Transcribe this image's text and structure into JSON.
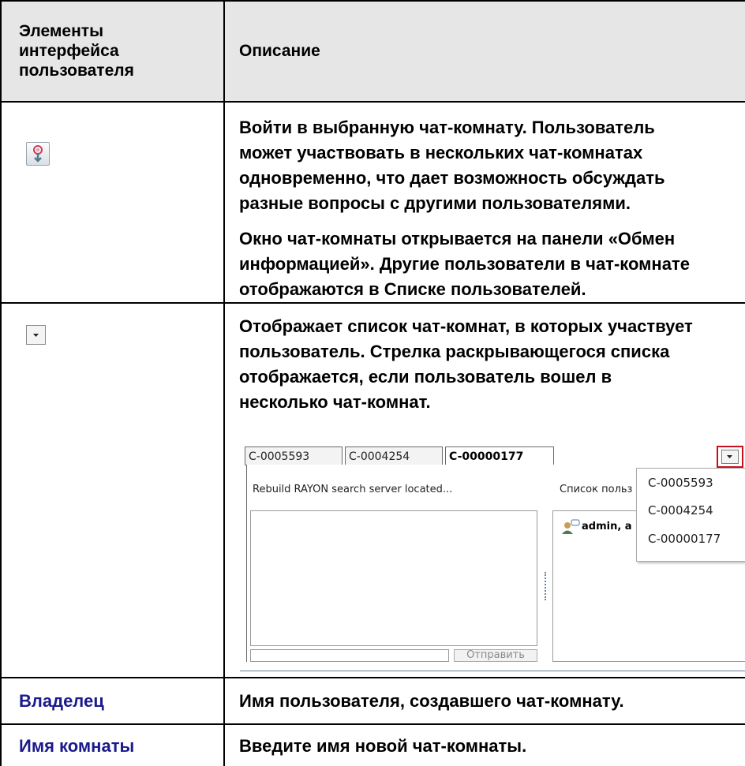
{
  "table": {
    "header": {
      "col1": [
        "Элементы",
        "интерфейса",
        "пользователя"
      ],
      "col2": "Описание"
    },
    "rows": [
      {
        "icon": "enter-chat-room-icon",
        "paragraphs": [
          [
            "Войти в выбранную чат-комнату. Пользователь",
            "может участвовать в нескольких чат-комнатах",
            "одновременно, что дает возможность обсуждать",
            "разные вопросы с другими пользователями."
          ],
          [
            "Окно чат-комнаты открывается на панели «Обмен",
            "информацией». Другие пользователи в чат-комнате",
            "отображаются в Списке пользователей."
          ]
        ]
      },
      {
        "icon": "dropdown-arrow-icon",
        "paragraphs": [
          [
            "Отображает список чат-комнат, в которых участвует",
            "пользователь. Стрелка раскрывающегося списка",
            "отображается, если пользователь вошел в",
            "несколько чат-комнат."
          ]
        ],
        "screenshot": {
          "tabs": [
            "C-0005593",
            "C-0004254",
            "C-00000177"
          ],
          "topic": "Rebuild RAYON search server located...",
          "users_label": "Список польз",
          "user_entry": "admin, a",
          "send_button": "Отправить",
          "dropdown_items": [
            "C-0005593",
            "C-0004254",
            "C-00000177"
          ]
        }
      },
      {
        "label": "Владелец",
        "description": "Имя пользователя, создавшего чат-комнату."
      },
      {
        "label": "Имя комнаты",
        "description": "Введите имя новой чат-комнаты."
      }
    ]
  },
  "colors": {
    "header_bg": "#e6e6e6",
    "link_text": "#1a1a8c",
    "highlight_border": "#c8101e"
  }
}
